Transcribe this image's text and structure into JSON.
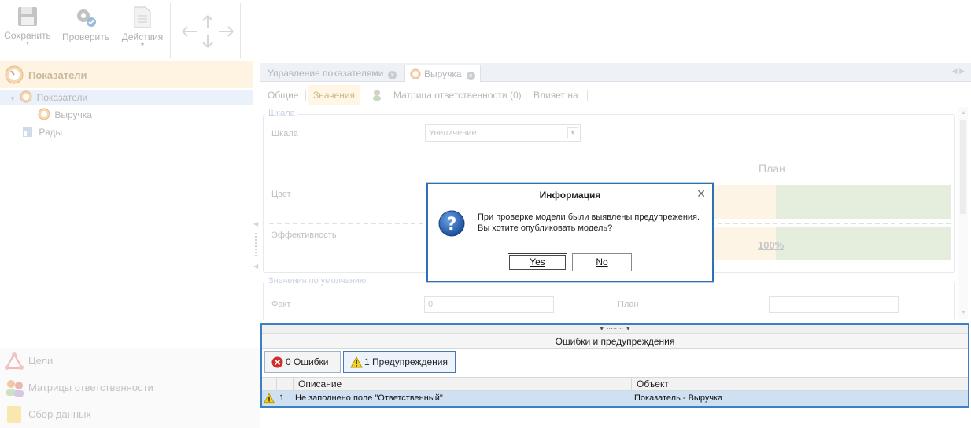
{
  "ribbon": {
    "save": "Сохранить",
    "check": "Проверить",
    "actions": "Действия"
  },
  "leftnav": {
    "header": "Показатели",
    "tree": [
      {
        "label": "Показатели"
      },
      {
        "label": "Выручка"
      },
      {
        "label": "Ряды"
      }
    ],
    "bottom": [
      "Цели",
      "Матрицы ответственности",
      "Сбор данных"
    ]
  },
  "tabs": [
    {
      "label": "Управление показателями"
    },
    {
      "label": "Выручка"
    }
  ],
  "subtabs": [
    "Общие",
    "Значения",
    "Матрица ответственности (0)",
    "Влияет на"
  ],
  "form": {
    "scale_group": "Шкала",
    "scale_label": "Шкала",
    "scale_value": "Увеличение",
    "plan_header": "План",
    "color_label": "Цвет",
    "efficiency_label": "Эффективность",
    "efficiency_value": "100%",
    "defaults_group": "Значения по умолчанию",
    "fact_label": "Факт",
    "fact_value": "0",
    "plan_label": "План",
    "plan_value": ""
  },
  "errors_panel": {
    "caption": "Ошибки и предупреждения",
    "errors_btn": "0 Ошибки",
    "warnings_btn": "1 Предупреждения",
    "columns": [
      "Описание",
      "Объект"
    ],
    "rows": [
      {
        "num": "1",
        "description": "Не заполнено поле \"Ответственный\"",
        "object": "Показатель - Выручка"
      }
    ]
  },
  "dialog": {
    "title": "Информация",
    "line1": "При проверке модели были выявлены предупрежения.",
    "line2": "Вы хотите опубликовать модель?",
    "yes": "Yes",
    "no": "No"
  },
  "colors": {
    "accent": "#2f6fb5",
    "highlight_row": "#cfe0f3",
    "nav_header": "#fff4e2"
  }
}
